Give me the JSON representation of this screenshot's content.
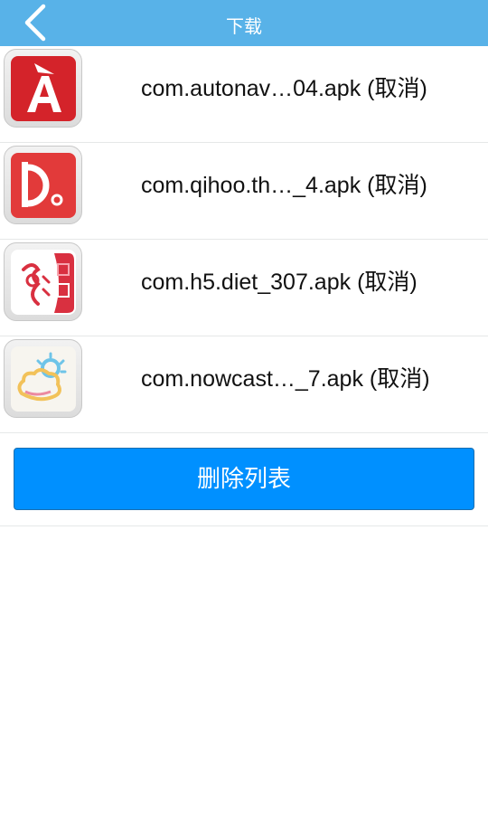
{
  "topbar": {
    "title": "下载"
  },
  "downloads": [
    {
      "file_name": "com.autonav…04.apk",
      "cancel_label": "(取消)",
      "icon": "amap-icon"
    },
    {
      "file_name": "com.qihoo.th…_4.apk",
      "cancel_label": "(取消)",
      "icon": "qihoo-icon"
    },
    {
      "file_name": "com.h5.diet_307.apk",
      "cancel_label": "(取消)",
      "icon": "diet-app-icon"
    },
    {
      "file_name": "com.nowcast…_7.apk",
      "cancel_label": "(取消)",
      "icon": "weather-icon"
    }
  ],
  "actions": {
    "delete_list_label": "删除列表"
  },
  "colors": {
    "topbar": "#58b2e8",
    "button": "#0090ff",
    "icon_red": "#e02b2b"
  }
}
